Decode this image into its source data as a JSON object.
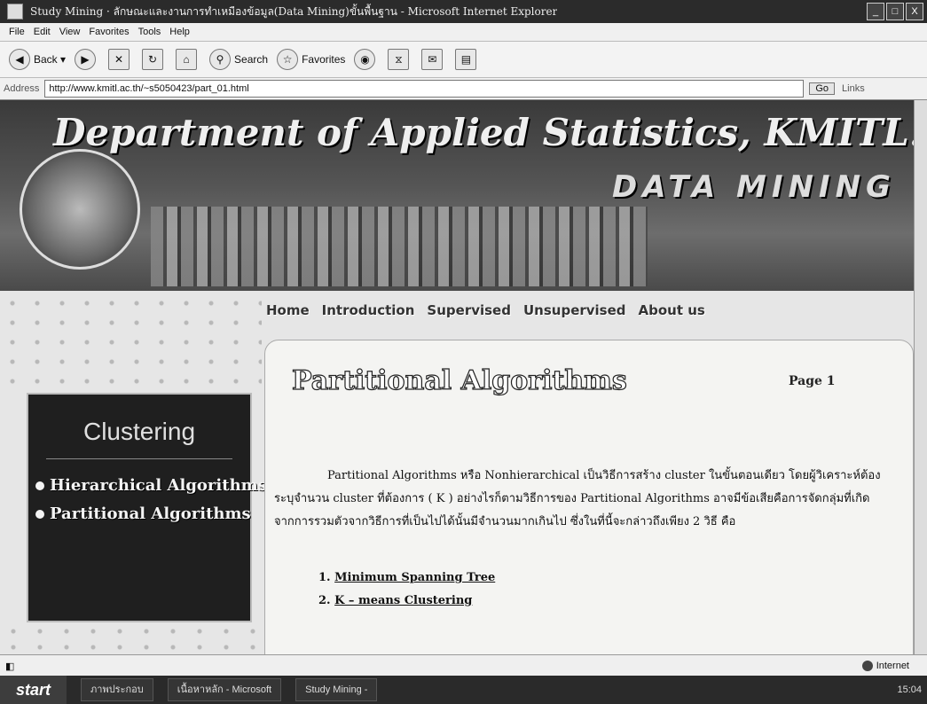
{
  "window": {
    "title": "Study Mining · ลักษณะและงานการทำเหมืองข้อมูล(Data Mining)ขั้นพื้นฐาน - Microsoft Internet Explorer",
    "controls": [
      "_",
      "□",
      "X"
    ]
  },
  "menu": [
    "File",
    "Edit",
    "View",
    "Favorites",
    "Tools",
    "Help"
  ],
  "toolbar": {
    "back": "Back",
    "search": "Search",
    "favorites": "Favorites"
  },
  "address": {
    "label": "Address",
    "url": "http://www.kmitl.ac.th/~s5050423/part_01.html",
    "go": "Go",
    "links": "Links"
  },
  "banner": {
    "title": "Department of Applied Statistics, KMITL.",
    "subtitle": "DATA MINING"
  },
  "nav": [
    "Home",
    "Introduction",
    "Supervised",
    "Unsupervised",
    "About us"
  ],
  "sidebar": {
    "title": "Clustering",
    "items": [
      "Hierarchical Algorithms",
      "Partitional Algorithms"
    ]
  },
  "content": {
    "title": "Partitional Algorithms",
    "page": "Page 1",
    "paragraph": "Partitional Algorithms หรือ Nonhierarchical เป็นวิธีการสร้าง cluster ในขั้นตอนเดียว โดยผู้วิเคราะห์ต้องระบุจำนวน cluster ที่ต้องการ ( K ) อย่างไรก็ตามวิธีการของ Partitional Algorithms อาจมีข้อเสียคือการจัดกลุ่มที่เกิดจากการรวมตัวจากวิธีการที่เป็นไปได้นั้นมีจำนวนมากเกินไป ซึ่งในที่นี้จะกล่าวถึงเพียง 2 วิธี คือ",
    "list": [
      {
        "num": "1.",
        "text": "Minimum Spanning Tree"
      },
      {
        "num": "2.",
        "text": "K – means Clustering"
      }
    ]
  },
  "status": {
    "zone": "Internet"
  },
  "taskbar": {
    "start": "start",
    "tasks": [
      "ภาพประกอบ",
      "เนื้อหาหลัก - Microsoft",
      "Study Mining -"
    ],
    "clock": "15:04"
  }
}
